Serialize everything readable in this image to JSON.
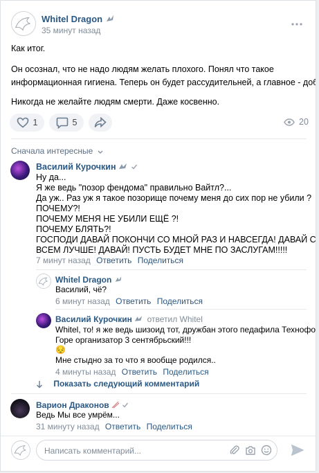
{
  "post": {
    "author": "Whitel Dragon",
    "time": "35 минут назад",
    "paragraphs": [
      "Как итог.",
      "Он осознал, что не надо людям желать плохого. Понял что такое\nинформационная гигиена. Теперь он будет рассудительней, а главное - добрее.",
      "Никогда не желайте людям смерти. Даже косвенно."
    ],
    "likes": "1",
    "comments": "5",
    "views": "20"
  },
  "sort_label": "Сначала интересные",
  "comments": [
    {
      "author": "Василий Курочкин",
      "text": "Ну да...\nЯ же ведь \"позор фендома\" правильно Вайтл?...\nДа уж.. Раз уж я такое позорище почему меня до сих пор не убили ?\nПОЧЕМУ?!\nПОЧЕМУ МЕНЯ НЕ УБИЛИ ЕЩЁ ?!\nПОЧЕМУ БЛЯТЬ?!\nГОСПОДИ ДАВАЙ ПОКОНЧИ СО МНОЙ РАЗ И НАВСЕГДА! ДАВАЙ СДЕЛАЙ\nВСЕМ ЛУЧШЕ! ДАВАЙ! ПУСТЬ БУДЕТ МНЕ ПО ЗАСЛУГАМ!!!!!",
      "time": "7 минут назад",
      "reply": "Ответить",
      "share": "Поделиться"
    },
    {
      "author": "Whitel Dragon",
      "text": "Василий, чё?",
      "time": "6 минут назад",
      "reply": "Ответить",
      "share": "Поделиться"
    },
    {
      "author": "Василий Курочкин",
      "replied_to": "ответил Whitel",
      "text": "Whitel, то! я же ведь шизоид тот, дружбан этого педафила Технофокса!\nГоре организатор 3 сентябрьский!!!",
      "emoji": "😔",
      "text2": "Мне стыдно за то что я вообще родился..",
      "time": "4 минуты назад",
      "reply": "Ответить",
      "share": "Поделиться"
    },
    {
      "author": "Варион Драконов",
      "text": "Ведь Мы все умрём...",
      "time": "31 минуту назад",
      "reply": "Ответить",
      "share": "Поделиться"
    }
  ],
  "show_next": "Показать следующий комментарий",
  "composer": {
    "placeholder": "Написать комментарий..."
  },
  "colors": {
    "link": "#2a5885",
    "meta": "#818c99",
    "accent": "#5181b8"
  },
  "icons": [
    "dragon-avatar-icon",
    "heart-icon",
    "comment-icon",
    "share-icon",
    "eye-icon",
    "more-icon",
    "verified-icon",
    "paperclip-icon",
    "camera-icon",
    "smile-icon",
    "send-icon"
  ]
}
